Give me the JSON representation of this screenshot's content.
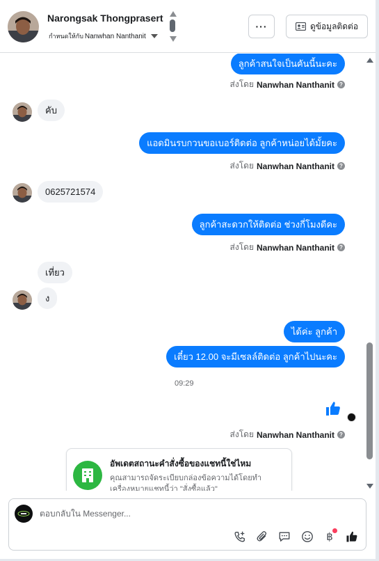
{
  "header": {
    "contact_name": "Narongsak Thongprasert",
    "assign_prefix": "กำหนดให้กับ",
    "assignee": "Nanwhan Nanthanit",
    "more_label": "···",
    "contact_info_label": "ดูข้อมูลติดต่อ"
  },
  "messages": [
    {
      "text": "ลูกค้าสนใจเป็นคันนี้นะคะ",
      "sender_prefix": "ส่งโดย",
      "sender": "Nanwhan Nanthanit"
    },
    {
      "text": "คับ"
    },
    {
      "text": "แอดมินรบกวนขอเบอร์ติดต่อ ลูกค้าหน่อยได้มั้ยคะ",
      "sender_prefix": "ส่งโดย",
      "sender": "Nanwhan Nanthanit"
    },
    {
      "text": "0625721574"
    },
    {
      "text": "ลูกค้าสะดวกให้ติดต่อ ช่วงกี่โมงดีคะ",
      "sender_prefix": "ส่งโดย",
      "sender": "Nanwhan Nanthanit"
    },
    {
      "text": "เที่ยว"
    },
    {
      "text": "ง"
    },
    {
      "text": "ได้ค่ะ  ลูกค้า"
    },
    {
      "text": "เตี๋ยว 12.00 จะมีเซลล์ติดต่อ ลูกค้าไปนะคะ"
    }
  ],
  "timestamp": "09:29",
  "like_sender": {
    "prefix": "ส่งโดย",
    "name": "Nanwhan Nanthanit"
  },
  "status_card": {
    "title": "อัพเดตสถานะคำสั่งซื้อของแชทนี้ใช่ไหม",
    "description": "คุณสามารถจัดระเบียบกล่องข้อความได้โดยทำเครื่องหมายแชทนี้ว่า \"สั่งซื้อแล้ว\""
  },
  "composer": {
    "placeholder": "ตอบกลับใน Messenger..."
  },
  "tools": [
    "call-add-icon",
    "attachment-icon",
    "saved-reply-icon",
    "emoji-icon",
    "baht-icon",
    "thumbs-up-icon"
  ],
  "colors": {
    "outgoing_bubble": "#0a7cff",
    "incoming_bubble": "#f0f2f5",
    "status_green": "#2db742",
    "notification_red": "#fa3e5e"
  }
}
